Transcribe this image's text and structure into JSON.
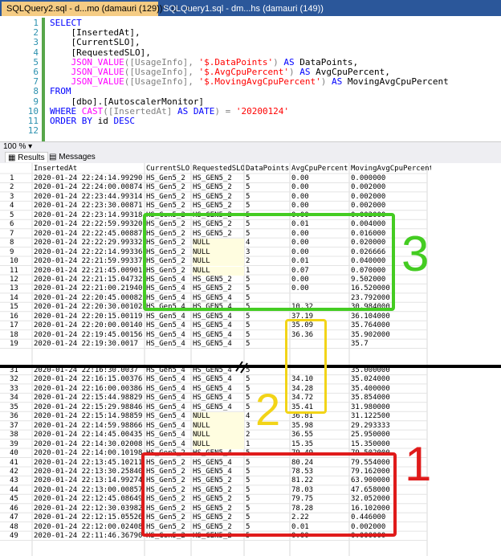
{
  "tabs": [
    {
      "label": "SQLQuery2.sql - d...mo (damauri (129))*",
      "pin": "⊡",
      "close": "✕"
    },
    {
      "label": "SQLQuery1.sql - dm...hs (damauri (149))"
    }
  ],
  "editor": {
    "line_numbers": [
      "1",
      "2",
      "3",
      "4",
      "5",
      "6",
      "7",
      "8",
      "9",
      "10",
      "11",
      "12"
    ],
    "lines": [
      [
        {
          "t": "SELECT",
          "c": "kw"
        }
      ],
      [
        {
          "t": "    [InsertedAt],",
          "c": ""
        }
      ],
      [
        {
          "t": "    [CurrentSLO],",
          "c": ""
        }
      ],
      [
        {
          "t": "    [RequestedSLO],",
          "c": ""
        }
      ],
      [
        {
          "t": "    ",
          "c": ""
        },
        {
          "t": "JSON_VALUE",
          "c": "fn"
        },
        {
          "t": "([UsageInfo], ",
          "c": "gr"
        },
        {
          "t": "'$.DataPoints'",
          "c": "st"
        },
        {
          "t": ") ",
          "c": "gr"
        },
        {
          "t": "AS",
          "c": "kw"
        },
        {
          "t": " DataPoints,",
          "c": ""
        }
      ],
      [
        {
          "t": "    ",
          "c": ""
        },
        {
          "t": "JSON_VALUE",
          "c": "fn"
        },
        {
          "t": "([UsageInfo], ",
          "c": "gr"
        },
        {
          "t": "'$.AvgCpuPercent'",
          "c": "st"
        },
        {
          "t": ") ",
          "c": "gr"
        },
        {
          "t": "AS",
          "c": "kw"
        },
        {
          "t": " AvgCpuPercent,",
          "c": ""
        }
      ],
      [
        {
          "t": "    ",
          "c": ""
        },
        {
          "t": "JSON_VALUE",
          "c": "fn"
        },
        {
          "t": "([UsageInfo], ",
          "c": "gr"
        },
        {
          "t": "'$.MovingAvgCpuPercent'",
          "c": "st"
        },
        {
          "t": ") ",
          "c": "gr"
        },
        {
          "t": "AS",
          "c": "kw"
        },
        {
          "t": " MovingAvgCpuPercent",
          "c": ""
        }
      ],
      [
        {
          "t": "FROM",
          "c": "kw"
        }
      ],
      [
        {
          "t": "    [dbo].[AutoscalerMonitor]",
          "c": ""
        }
      ],
      [
        {
          "t": "WHERE",
          "c": "kw"
        },
        {
          "t": " ",
          "c": ""
        },
        {
          "t": "CAST",
          "c": "fn"
        },
        {
          "t": "([InsertedAt] ",
          "c": "gr"
        },
        {
          "t": "AS DATE",
          "c": "kw"
        },
        {
          "t": ") = ",
          "c": "gr"
        },
        {
          "t": "'20200124'",
          "c": "st"
        }
      ],
      [
        {
          "t": "ORDER BY",
          "c": "kw"
        },
        {
          "t": " id ",
          "c": ""
        },
        {
          "t": "DESC",
          "c": "kw"
        }
      ],
      [
        {
          "t": "",
          "c": ""
        }
      ]
    ]
  },
  "zoom": "100 %",
  "result_tabs": {
    "results": "Results",
    "messages": "Messages"
  },
  "grid": {
    "headers": [
      "InsertedAt",
      "CurrentSLO",
      "RequestedSLO",
      "DataPoints",
      "AvgCpuPercent",
      "MovingAvgCpuPercent"
    ],
    "rows_top": [
      [
        "1",
        "2020-01-24 22:24:14.9929084",
        "HS_Gen5_2",
        "HS_GEN5_2",
        "5",
        "0.00",
        "0.000000"
      ],
      [
        "2",
        "2020-01-24 22:24:00.0087424",
        "HS_Gen5_2",
        "HS_GEN5_2",
        "5",
        "0.00",
        "0.002000"
      ],
      [
        "3",
        "2020-01-24 22:23:44.9931455",
        "HS_Gen5_2",
        "HS_GEN5_2",
        "5",
        "0.00",
        "0.002000"
      ],
      [
        "4",
        "2020-01-24 22:23:30.0087119",
        "HS_Gen5_2",
        "HS_GEN5_2",
        "5",
        "0.00",
        "0.002000"
      ],
      [
        "5",
        "2020-01-24 22:23:14.9931801",
        "HS_Gen5_2",
        "HS_GEN5_2",
        "5",
        "0.00",
        "0.002000"
      ],
      [
        "6",
        "2020-01-24 22:22:59.9932072",
        "HS_Gen5_2",
        "HS_GEN5_2",
        "5",
        "0.01",
        "0.004000"
      ],
      [
        "7",
        "2020-01-24 22:22:45.0088792",
        "HS_Gen5_2",
        "HS_GEN5_2",
        "5",
        "0.00",
        "0.016000"
      ],
      [
        "8",
        "2020-01-24 22:22:29.9933213",
        "HS_Gen5_2",
        "NULL",
        "4",
        "0.00",
        "0.020000"
      ],
      [
        "9",
        "2020-01-24 22:22:14.9933644",
        "HS_Gen5_2",
        "NULL",
        "3",
        "0.00",
        "0.026666"
      ],
      [
        "10",
        "2020-01-24 22:21:59.9933739",
        "HS_Gen5_2",
        "NULL",
        "2",
        "0.01",
        "0.040000"
      ],
      [
        "11",
        "2020-01-24 22:21:45.0090199",
        "HS_Gen5_2",
        "NULL",
        "1",
        "0.07",
        "0.070000"
      ],
      [
        "12",
        "2020-01-24 22:21:15.0473205",
        "HS_Gen5_4",
        "HS_GEN5_2",
        "5",
        "0.00",
        "9.502000"
      ],
      [
        "13",
        "2020-01-24 22:21:00.2194000",
        "HS_Gen5_4",
        "HS_GEN5_2",
        "5",
        "0.00",
        "16.520000"
      ],
      [
        "14",
        "2020-01-24 22:20:45.0008244",
        "HS_Gen5_4",
        "HS_GEN5_4",
        "5",
        "",
        "23.792000"
      ],
      [
        "15",
        "2020-01-24 22:20:30.0010241",
        "HS_Gen5_4",
        "HS_GEN5_4",
        "5",
        "10.32",
        "30.984000"
      ],
      [
        "16",
        "2020-01-24 22:20:15.0011956",
        "HS_Gen5_4",
        "HS_GEN5_4",
        "5",
        "37.19",
        "36.104000"
      ],
      [
        "17",
        "2020-01-24 22:20:00.0014016",
        "HS_Gen5_4",
        "HS_GEN5_4",
        "5",
        "35.09",
        "35.764000"
      ],
      [
        "18",
        "2020-01-24 22:19:45.0015689",
        "HS_Gen5_4",
        "HS_GEN5_4",
        "5",
        "36.36",
        "35.902000"
      ],
      [
        "19",
        "2020-01-24 22:19:30.0017",
        "HS_Gen5_4",
        "HS_GEN5_4",
        "5",
        "",
        "35.7"
      ]
    ],
    "rows_bottom": [
      [
        "31",
        "2020-01-24 22:16:30.0037",
        "HS_Gen5_4",
        "HS_GEN5_4",
        "5",
        "",
        "35.000000"
      ],
      [
        "32",
        "2020-01-24 22:16:15.0037672",
        "HS_Gen5_4",
        "HS_GEN5_4",
        "5",
        "34.10",
        "35.024000"
      ],
      [
        "33",
        "2020-01-24 22:16:00.0038650",
        "HS_Gen5_4",
        "HS_GEN5_4",
        "5",
        "34.28",
        "35.400000"
      ],
      [
        "34",
        "2020-01-24 22:15:44.9882931",
        "HS_Gen5_4",
        "HS_GEN5_4",
        "5",
        "34.72",
        "35.854000"
      ],
      [
        "35",
        "2020-01-24 22:15:29.9884606",
        "HS_Gen5_4",
        "HS_GEN5_4",
        "5",
        "35.41",
        "31.980000"
      ],
      [
        "36",
        "2020-01-24 22:15:14.9885926",
        "HS_Gen5_4",
        "NULL",
        "4",
        "36.81",
        "31.122500"
      ],
      [
        "37",
        "2020-01-24 22:14:59.9886678",
        "HS_Gen5_4",
        "NULL",
        "3",
        "35.98",
        "29.293333"
      ],
      [
        "38",
        "2020-01-24 22:14:45.0043594",
        "HS_Gen5_4",
        "NULL",
        "2",
        "36.55",
        "25.950000"
      ],
      [
        "39",
        "2020-01-24 22:14:30.0200807",
        "HS_Gen5_4",
        "NULL",
        "1",
        "15.35",
        "15.350000"
      ],
      [
        "40",
        "2020-01-24 22:14:00.1019830",
        "HS_Gen5_2",
        "HS_GEN5_4",
        "5",
        "79.49",
        "79.502000"
      ],
      [
        "41",
        "2020-01-24 22:13:45.1021131",
        "HS_Gen5_2",
        "HS_GEN5_4",
        "5",
        "80.24",
        "79.554000"
      ],
      [
        "42",
        "2020-01-24 22:13:30.2584008",
        "HS_Gen5_2",
        "HS_GEN5_4",
        "5",
        "78.53",
        "79.162000"
      ],
      [
        "43",
        "2020-01-24 22:13:14.9927461",
        "HS_Gen5_2",
        "HS_GEN5_2",
        "5",
        "81.22",
        "63.900000"
      ],
      [
        "44",
        "2020-01-24 22:13:00.0085793",
        "HS_Gen5_2",
        "HS_GEN5_2",
        "5",
        "78.03",
        "47.658000"
      ],
      [
        "45",
        "2020-01-24 22:12:45.0864971",
        "HS_Gen5_2",
        "HS_GEN5_2",
        "5",
        "79.75",
        "32.052000"
      ],
      [
        "46",
        "2020-01-24 22:12:30.0398229",
        "HS_Gen5_2",
        "HS_GEN5_2",
        "5",
        "78.28",
        "16.102000"
      ],
      [
        "47",
        "2020-01-24 22:12:15.0552658",
        "HS_Gen5_2",
        "HS_GEN5_2",
        "5",
        "2.22",
        "0.446000"
      ],
      [
        "48",
        "2020-01-24 22:12:00.0240849",
        "HS_Gen5_2",
        "HS_GEN5_2",
        "5",
        "0.01",
        "0.002000"
      ],
      [
        "49",
        "2020-01-24 22:11:46.3679029",
        "HS_Gen5_2",
        "HS_GEN5_2",
        "5",
        "0.00",
        "0.000000"
      ]
    ]
  },
  "annotations": [
    {
      "label": "3",
      "color": "#44cc22"
    },
    {
      "label": "2",
      "color": "#f2d418"
    },
    {
      "label": "1",
      "color": "#e01b1b"
    }
  ]
}
